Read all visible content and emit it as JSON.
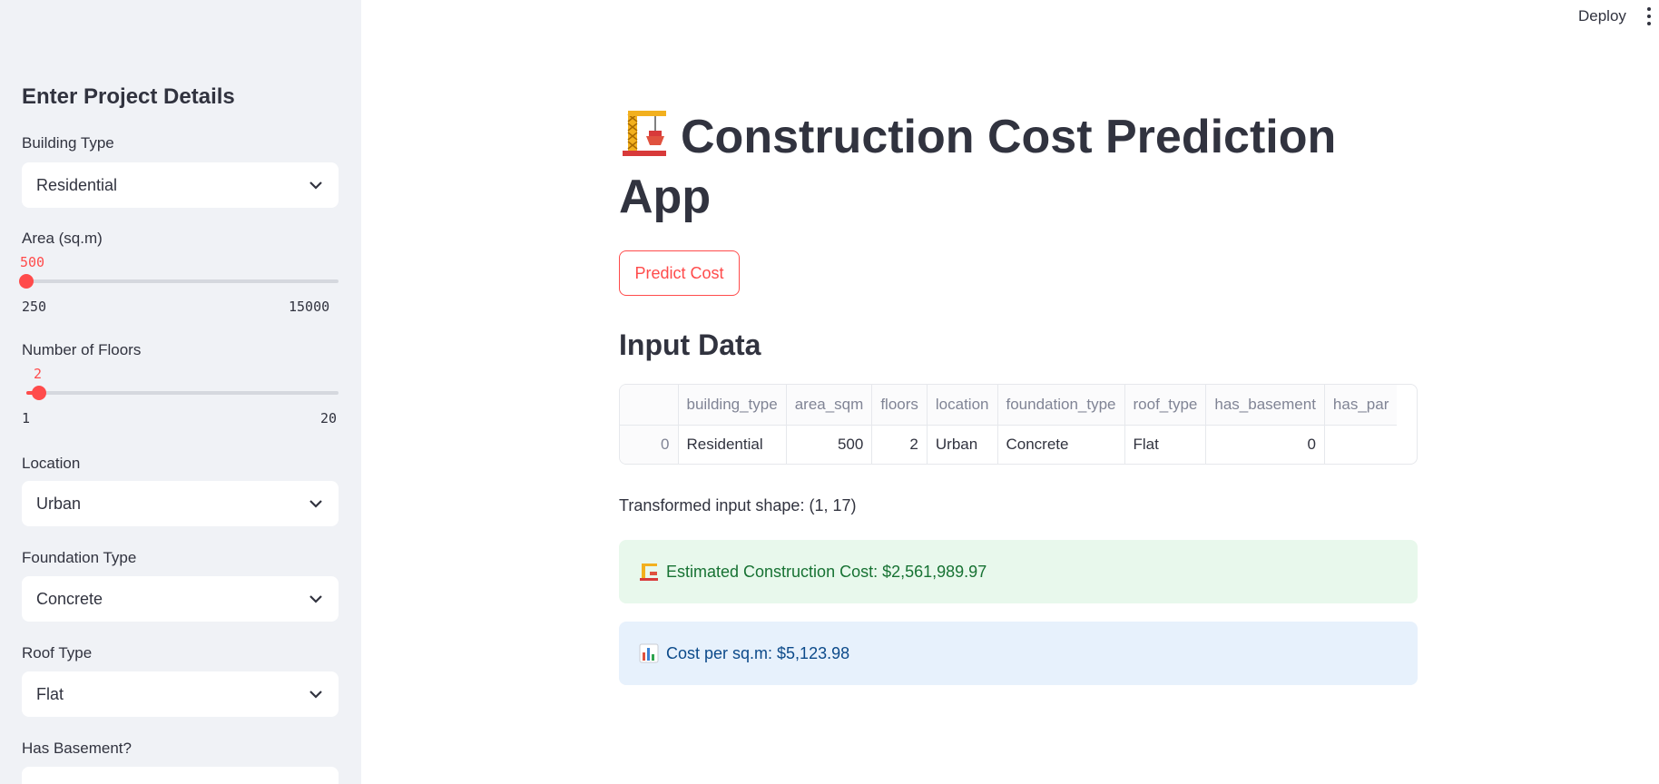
{
  "header": {
    "deploy_label": "Deploy",
    "menu_icon": "vertical-dots-icon"
  },
  "sidebar": {
    "title": "Enter Project Details",
    "building_type": {
      "label": "Building Type",
      "value": "Residential"
    },
    "area": {
      "label": "Area (sq.m)",
      "value": "500",
      "min": "250",
      "max": "15000",
      "fraction": 0.017
    },
    "floors": {
      "label": "Number of Floors",
      "value": "2",
      "min": "1",
      "max": "20",
      "fraction": 0.053
    },
    "location": {
      "label": "Location",
      "value": "Urban"
    },
    "foundation_type": {
      "label": "Foundation Type",
      "value": "Concrete"
    },
    "roof_type": {
      "label": "Roof Type",
      "value": "Flat"
    },
    "has_basement": {
      "label": "Has Basement?"
    }
  },
  "main": {
    "title": "Construction Cost Prediction App",
    "title_icon": "crane-icon",
    "predict_button": "Predict Cost",
    "input_heading": "Input Data",
    "table": {
      "columns": [
        "",
        "building_type",
        "area_sqm",
        "floors",
        "location",
        "foundation_type",
        "roof_type",
        "has_basement",
        "has_par"
      ],
      "rows": [
        [
          "0",
          "Residential",
          "500",
          "2",
          "Urban",
          "Concrete",
          "Flat",
          "0",
          ""
        ]
      ]
    },
    "shape_text": "Transformed input shape: (1, 17)",
    "cost_alert": "Estimated Construction Cost: $2,561,989.97",
    "cost_alert_icon": "crane-icon",
    "per_sqm_alert": "Cost per sq.m: $5,123.98",
    "per_sqm_alert_icon": "bar-chart-icon"
  },
  "colors": {
    "accent": "#ff4b4b",
    "sidebar_bg": "#f0f2f6",
    "success_bg": "#e8f8ec",
    "success_text": "#177233",
    "info_bg": "#e7f1fc",
    "info_text": "#0c4a8a"
  }
}
